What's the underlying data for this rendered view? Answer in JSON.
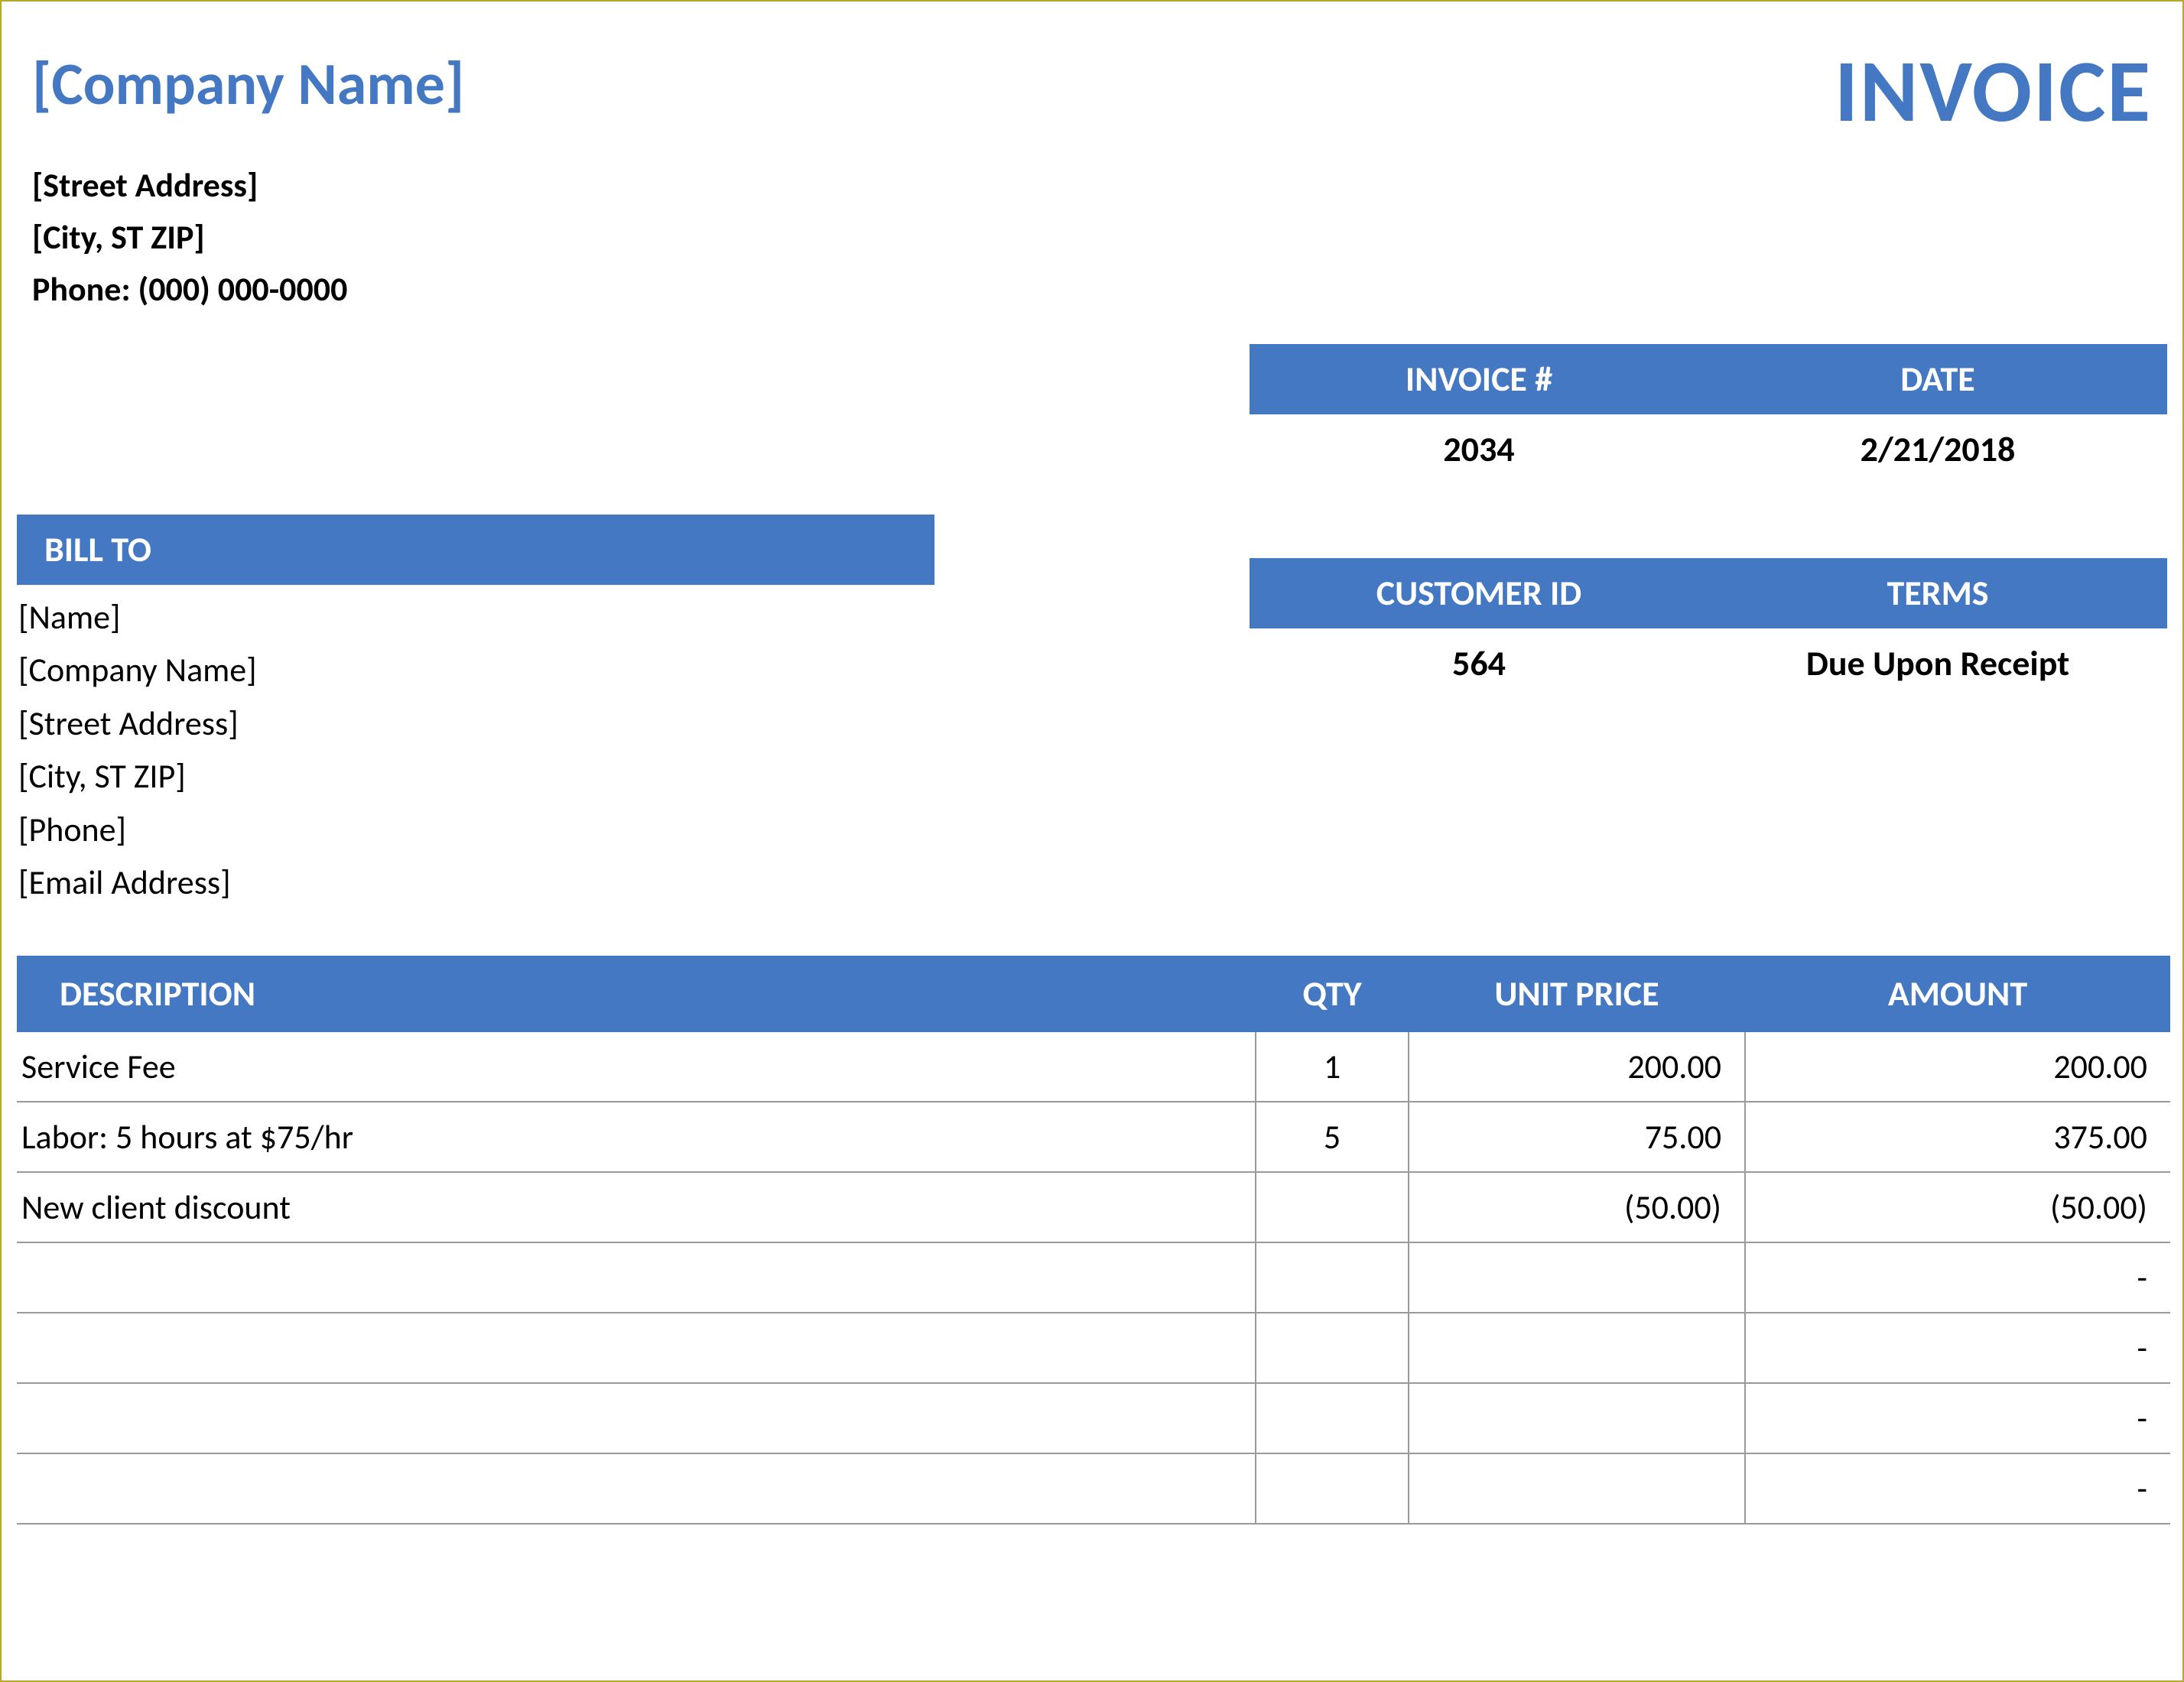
{
  "header": {
    "company_name": "[Company Name]",
    "invoice_title": "INVOICE"
  },
  "company": {
    "street": "[Street Address]",
    "city_line": "[City, ST  ZIP]",
    "phone": "Phone: (000) 000-0000"
  },
  "meta": {
    "invoice_num_label": "INVOICE #",
    "date_label": "DATE",
    "invoice_num": "2034",
    "date": "2/21/2018",
    "customer_id_label": "CUSTOMER ID",
    "terms_label": "TERMS",
    "customer_id": "564",
    "terms": "Due Upon Receipt"
  },
  "bill_to": {
    "label": "BILL TO",
    "name": "[Name]",
    "company": "[Company Name]",
    "street": "[Street Address]",
    "city_line": "[City, ST  ZIP]",
    "phone": "[Phone]",
    "email": "[Email Address]"
  },
  "table": {
    "head": {
      "description": "DESCRIPTION",
      "qty": "QTY",
      "unit_price": "UNIT PRICE",
      "amount": "AMOUNT"
    },
    "rows": [
      {
        "description": "Service Fee",
        "qty": "1",
        "unit_price": "200.00",
        "amount": "200.00"
      },
      {
        "description": "Labor: 5 hours at $75/hr",
        "qty": "5",
        "unit_price": "75.00",
        "amount": "375.00"
      },
      {
        "description": "New client discount",
        "qty": "",
        "unit_price": "(50.00)",
        "amount": "(50.00)"
      },
      {
        "description": "",
        "qty": "",
        "unit_price": "",
        "amount": "-"
      },
      {
        "description": "",
        "qty": "",
        "unit_price": "",
        "amount": "-"
      },
      {
        "description": "",
        "qty": "",
        "unit_price": "",
        "amount": "-"
      },
      {
        "description": "",
        "qty": "",
        "unit_price": "",
        "amount": "-"
      }
    ]
  }
}
